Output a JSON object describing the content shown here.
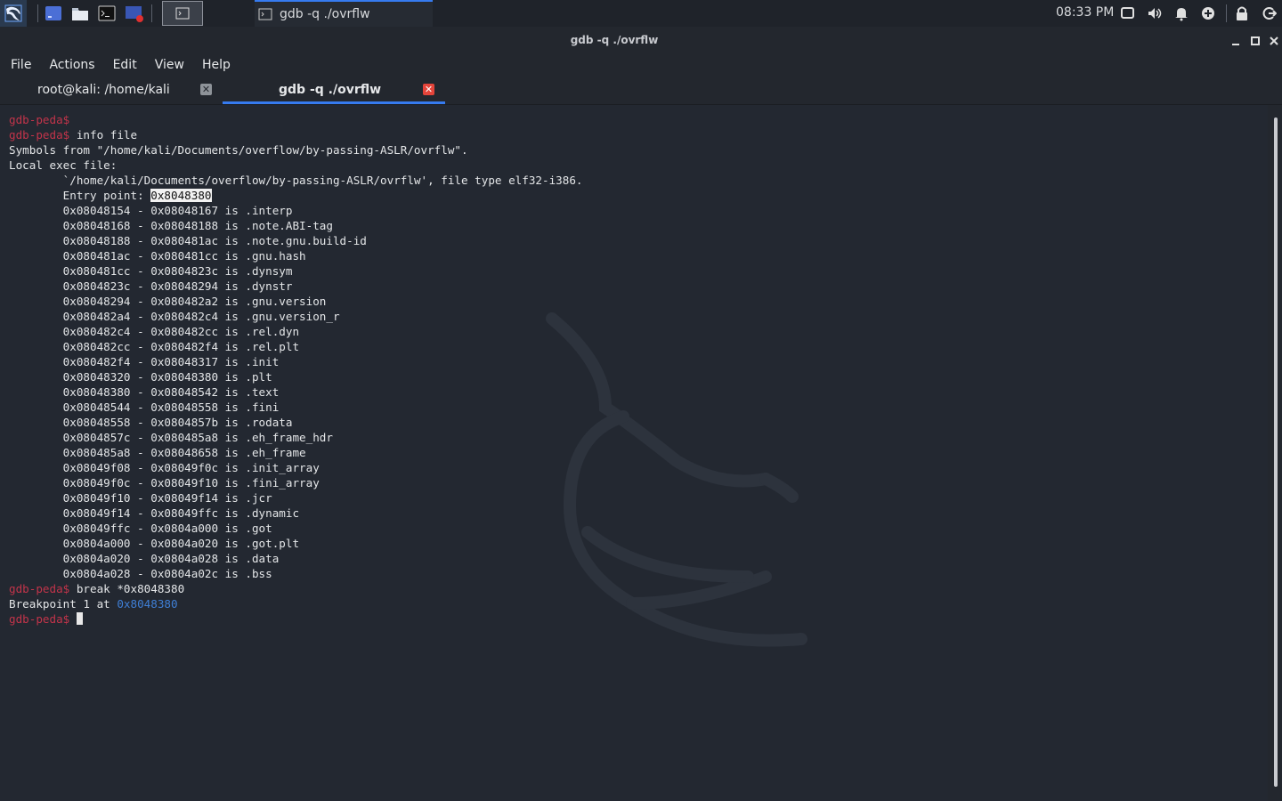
{
  "panel": {
    "clock": "08:33 PM",
    "taskbar_item": "gdb -q ./ovrflw",
    "launchers": [
      "workspace-icon",
      "file-manager-icon",
      "terminal-icon",
      "screen-record-icon"
    ],
    "tray_icons": [
      "display-icon",
      "volume-icon",
      "notification-bell-icon",
      "update-icon",
      "lock-icon",
      "logout-icon"
    ],
    "accent_color": "#367bf0"
  },
  "window": {
    "title": "gdb -q ./ovrflw"
  },
  "menubar": {
    "file": "File",
    "actions": "Actions",
    "edit": "Edit",
    "view": "View",
    "help": "Help"
  },
  "tabs": [
    {
      "label": "root@kali: /home/kali",
      "active": false
    },
    {
      "label": "gdb -q ./ovrflw",
      "active": true
    }
  ],
  "terminal": {
    "prompt": "gdb-peda$",
    "commands": [
      "info file",
      "break *0x8048380"
    ],
    "symbols_line": "Symbols from \"/home/kali/Documents/overflow/by-passing-ASLR/ovrflw\".",
    "local_exec": "Local exec file:",
    "exec_path_line": "`/home/kali/Documents/overflow/by-passing-ASLR/ovrflw', file type elf32-i386.",
    "entry_label": "Entry point: ",
    "entry_point": "0x8048380",
    "sections": [
      "0x08048154 - 0x08048167 is .interp",
      "0x08048168 - 0x08048188 is .note.ABI-tag",
      "0x08048188 - 0x080481ac is .note.gnu.build-id",
      "0x080481ac - 0x080481cc is .gnu.hash",
      "0x080481cc - 0x0804823c is .dynsym",
      "0x0804823c - 0x08048294 is .dynstr",
      "0x08048294 - 0x080482a2 is .gnu.version",
      "0x080482a4 - 0x080482c4 is .gnu.version_r",
      "0x080482c4 - 0x080482cc is .rel.dyn",
      "0x080482cc - 0x080482f4 is .rel.plt",
      "0x080482f4 - 0x08048317 is .init",
      "0x08048320 - 0x08048380 is .plt",
      "0x08048380 - 0x08048542 is .text",
      "0x08048544 - 0x08048558 is .fini",
      "0x08048558 - 0x0804857b is .rodata",
      "0x0804857c - 0x080485a8 is .eh_frame_hdr",
      "0x080485a8 - 0x08048658 is .eh_frame",
      "0x08049f08 - 0x08049f0c is .init_array",
      "0x08049f0c - 0x08049f10 is .fini_array",
      "0x08049f10 - 0x08049f14 is .jcr",
      "0x08049f14 - 0x08049ffc is .dynamic",
      "0x08049ffc - 0x0804a000 is .got",
      "0x0804a000 - 0x0804a020 is .got.plt",
      "0x0804a020 - 0x0804a028 is .data",
      "0x0804a028 - 0x0804a02c is .bss"
    ],
    "breakpoint_text": "Breakpoint 1 at ",
    "breakpoint_addr": "0x8048380"
  }
}
